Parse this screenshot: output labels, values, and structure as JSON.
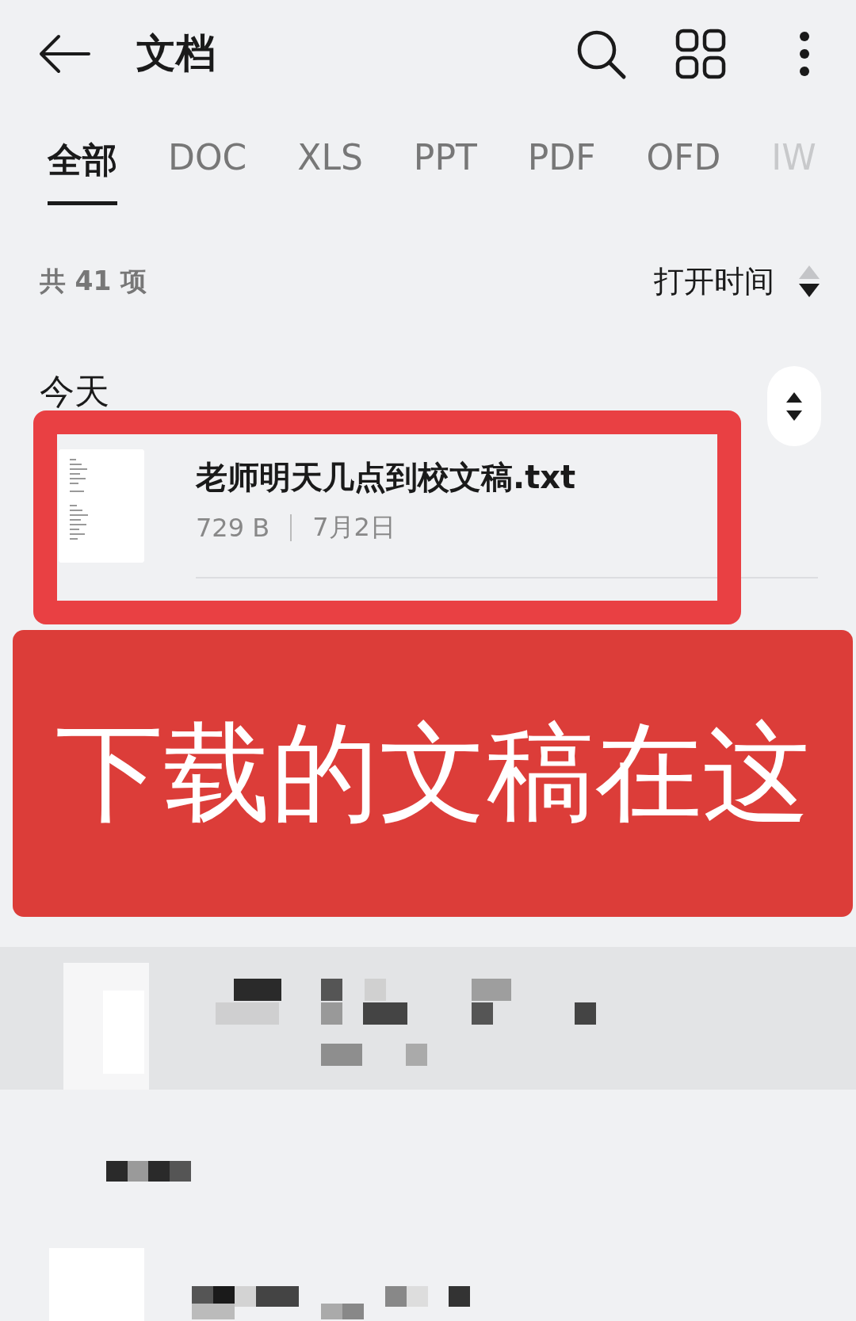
{
  "app_bar": {
    "title": "文档"
  },
  "tabs": [
    {
      "label": "全部",
      "selected": true
    },
    {
      "label": "DOC",
      "selected": false
    },
    {
      "label": "XLS",
      "selected": false
    },
    {
      "label": "PPT",
      "selected": false
    },
    {
      "label": "PDF",
      "selected": false
    },
    {
      "label": "OFD",
      "selected": false
    },
    {
      "label": "IW",
      "selected": false
    }
  ],
  "summary": {
    "count": "共 41 项",
    "sort_label": "打开时间"
  },
  "sections": [
    {
      "heading": "今天",
      "files": [
        {
          "name": "老师明天几点到校文稿.txt",
          "size": "729 B",
          "date": "7月2日"
        }
      ]
    }
  ],
  "annotation": {
    "banner": "下载的文稿在这"
  }
}
